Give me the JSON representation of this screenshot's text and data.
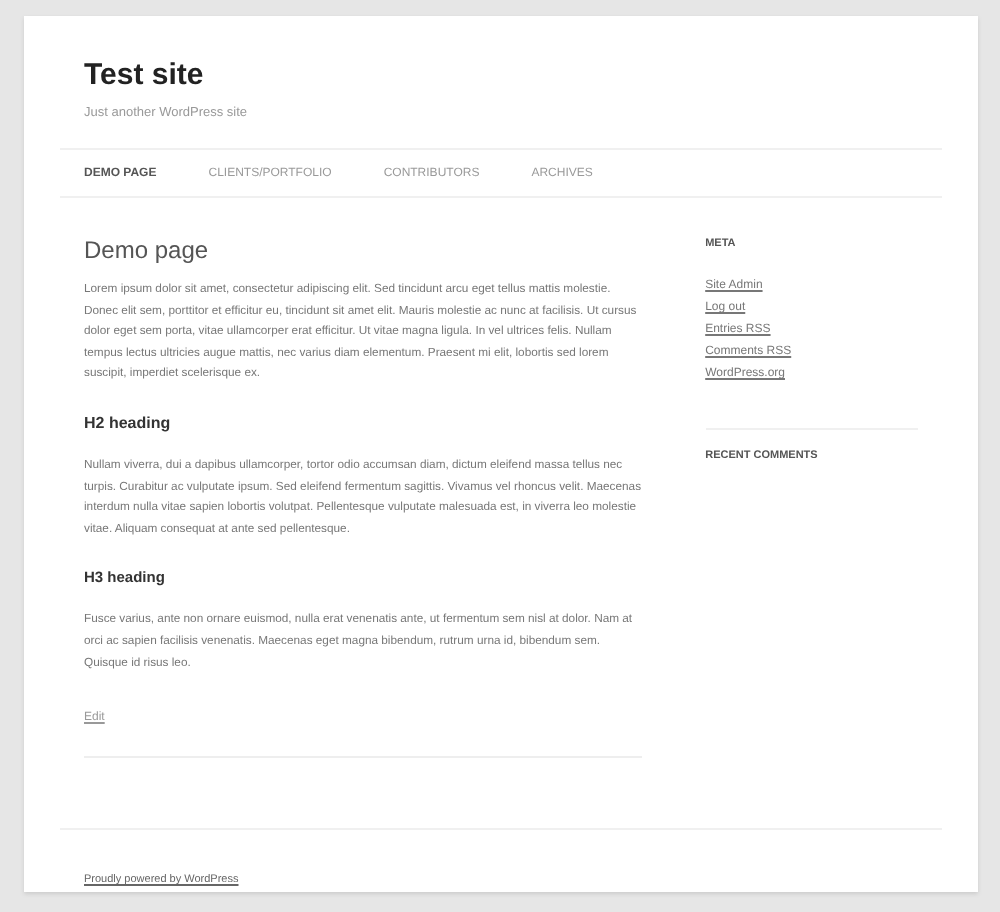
{
  "site": {
    "title": "Test site",
    "tagline": "Just another WordPress site"
  },
  "nav": [
    {
      "label": "DEMO PAGE",
      "selected": true
    },
    {
      "label": "CLIENTS/PORTFOLIO",
      "selected": false
    },
    {
      "label": "CONTRIBUTORS",
      "selected": false
    },
    {
      "label": "ARCHIVES",
      "selected": false
    }
  ],
  "article": {
    "title": "Demo page",
    "blocks": [
      {
        "kind": "p",
        "text": "Lorem ipsum dolor sit amet, consectetur adipiscing elit. Sed tincidunt arcu eget tellus mattis molestie. Donec elit sem, porttitor et efficitur eu, tincidunt sit amet elit. Mauris molestie ac nunc at facilisis. Ut cursus dolor eget sem porta, vitae ullamcorper erat efficitur. Ut vitae magna ligula. In vel ultrices felis. Nullam tempus lectus ultricies augue mattis, nec varius diam elementum. Praesent mi elit, lobortis sed lorem suscipit, imperdiet scelerisque ex."
      },
      {
        "kind": "h2",
        "text": "H2 heading"
      },
      {
        "kind": "p",
        "text": "Nullam viverra, dui a dapibus ullamcorper, tortor odio accumsan diam, dictum eleifend massa tellus nec turpis. Curabitur ac vulputate ipsum. Sed eleifend fermentum sagittis. Vivamus vel rhoncus velit. Maecenas interdum nulla vitae sapien lobortis volutpat. Pellentesque vulputate malesuada est, in viverra leo molestie vitae. Aliquam consequat at ante sed pellentesque."
      },
      {
        "kind": "h3",
        "text": "H3 heading"
      },
      {
        "kind": "p",
        "text": "Fusce varius, ante non ornare euismod, nulla erat venenatis ante, ut fermentum sem nisl at dolor. Nam at orci ac sapien facilisis venenatis. Maecenas eget magna bibendum, rutrum urna id, bibendum sem. Quisque id risus leo."
      }
    ],
    "edit_link": "Edit"
  },
  "sidebar": [
    {
      "title": "META",
      "links": [
        "Site Admin",
        "Log out",
        "Entries RSS",
        "Comments RSS",
        "WordPress.org"
      ]
    },
    {
      "title": "RECENT COMMENTS"
    }
  ],
  "footer": {
    "credit": "Proudly powered by WordPress"
  }
}
